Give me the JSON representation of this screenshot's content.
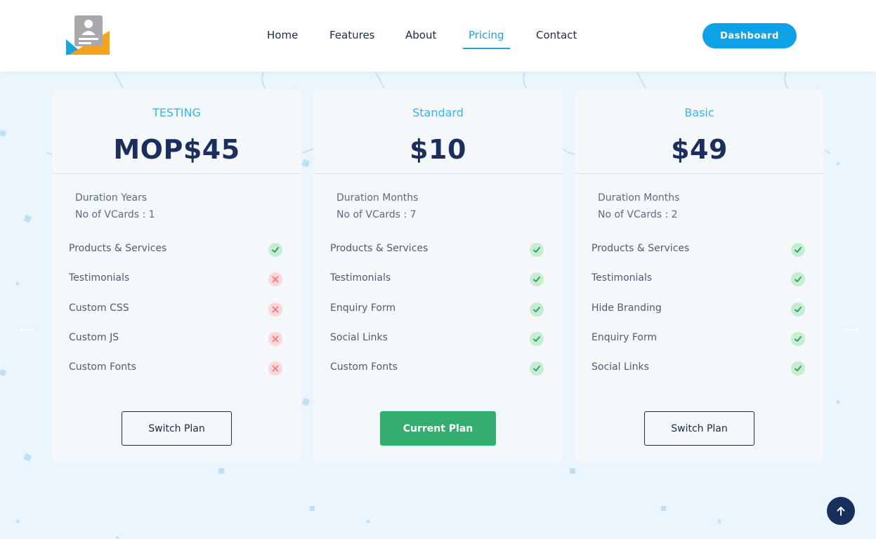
{
  "header": {
    "nav": [
      {
        "label": "Home",
        "active": false
      },
      {
        "label": "Features",
        "active": false
      },
      {
        "label": "About",
        "active": false
      },
      {
        "label": "Pricing",
        "active": true
      },
      {
        "label": "Contact",
        "active": false
      }
    ],
    "dashboard_label": "Dashboard"
  },
  "colors": {
    "accent": "#1aa3e0",
    "navy": "#1c2f5c",
    "green": "#34ae6e",
    "check_bg": "#c7ecd2",
    "cross_bg": "#fbd7d9",
    "page_bg": "#eaf5fd"
  },
  "plans": [
    {
      "name": "TESTING",
      "price": "MOP$45",
      "duration": "Duration Years",
      "vcards": "No of VCards : 1",
      "features": [
        {
          "label": "Products & Services",
          "included": true,
          "icon": "check-icon"
        },
        {
          "label": "Testimonials",
          "included": false,
          "icon": "cross-icon"
        },
        {
          "label": "Custom CSS",
          "included": false,
          "icon": "cross-icon"
        },
        {
          "label": "Custom JS",
          "included": false,
          "icon": "cross-icon"
        },
        {
          "label": "Custom Fonts",
          "included": false,
          "icon": "cross-icon"
        }
      ],
      "button": "Switch Plan"
    },
    {
      "name": "Standard",
      "price": "$10",
      "duration": "Duration Months",
      "vcards": "No of VCards : 7",
      "features": [
        {
          "label": "Products & Services",
          "included": true,
          "icon": "check-icon"
        },
        {
          "label": "Testimonials",
          "included": true,
          "icon": "check-icon"
        },
        {
          "label": "Enquiry Form",
          "included": true,
          "icon": "check-icon"
        },
        {
          "label": "Social Links",
          "included": true,
          "icon": "check-icon"
        },
        {
          "label": "Custom Fonts",
          "included": true,
          "icon": "check-icon"
        }
      ],
      "button": "Current Plan"
    },
    {
      "name": "Basic",
      "price": "$49",
      "duration": "Duration Months",
      "vcards": "No of VCards : 2",
      "features": [
        {
          "label": "Products & Services",
          "included": true,
          "icon": "check-icon"
        },
        {
          "label": "Testimonials",
          "included": true,
          "icon": "check-icon"
        },
        {
          "label": "Hide Branding",
          "included": true,
          "icon": "check-icon"
        },
        {
          "label": "Enquiry Form",
          "included": true,
          "icon": "check-icon"
        },
        {
          "label": "Social Links",
          "included": true,
          "icon": "check-icon"
        }
      ],
      "button": "Switch Plan"
    }
  ],
  "icons": {
    "scroll_top": "arrow-up-icon",
    "carousel_prev": "arrow-left-icon",
    "carousel_next": "arrow-right-icon",
    "logo": "vcard-logo-icon"
  }
}
